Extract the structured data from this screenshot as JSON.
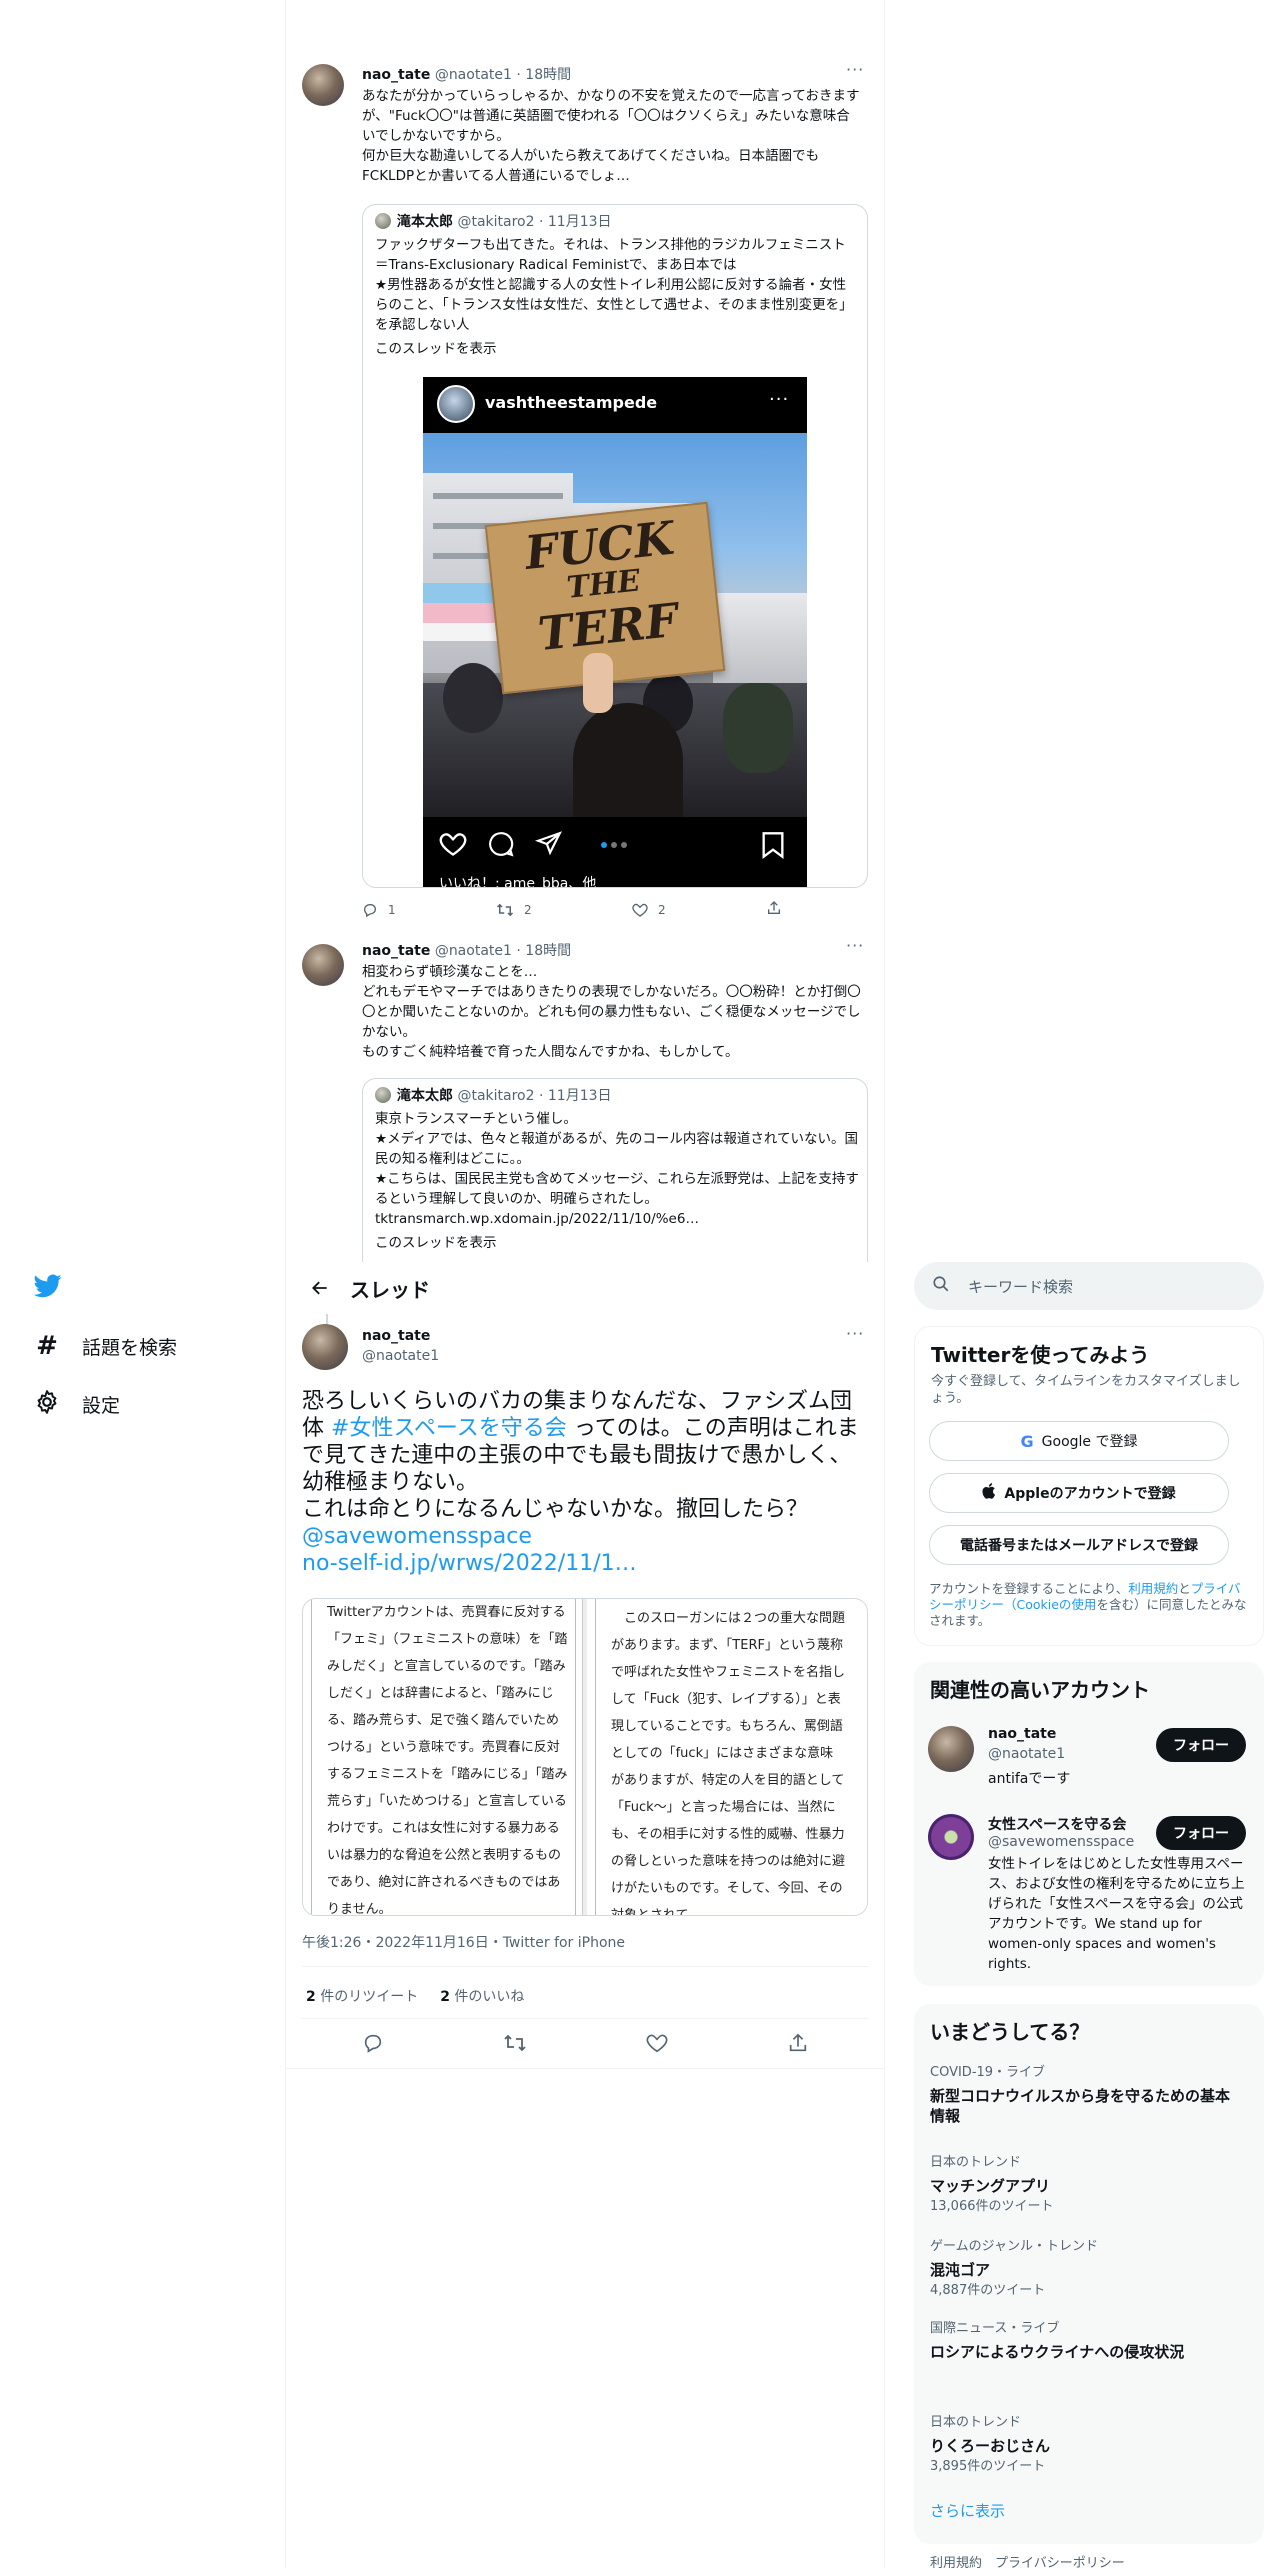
{
  "thread_top": {
    "tweet1": {
      "name": "nao_tate",
      "handle": "@naotate1",
      "time": "18時間",
      "text": "あなたが分かっていらっしゃるか、かなりの不安を覚えたので一応言っておきますが、\"Fuck〇〇\"は普通に英語圏で使われる「〇〇はクソくらえ」みたいな意味合いでしかないですから。\n何か巨大な勘違いしてる人がいたら教えてあげてくださいね。日本語圏でもFCKLDPとか書いてる人普通にいるでしょ…",
      "quote": {
        "name": "滝本太郎",
        "handle": "@takitaro2",
        "date": "11月13日",
        "text": "ファックザターフも出てきた。それは、トランス排他的ラジカルフェミニスト＝Trans-Exclusionary Radical Feministで、まあ日本では\n★男性器あるが女性と認識する人の女性トイレ利用公認に反対する論者・女性らのこと、「トランス女性は女性だ、女性として遇せよ、そのまま性別変更を」を承認しない人",
        "show_thread": "このスレッドを表示",
        "ig": {
          "username": "vashtheestampede",
          "sign_line1": "FUCK",
          "sign_line2": "THE",
          "sign_line3": "TERF",
          "likes_text": "いいね！: ame_bba、他"
        }
      },
      "replies": "1",
      "retweets": "2",
      "likes": "2"
    },
    "tweet2": {
      "name": "nao_tate",
      "handle": "@naotate1",
      "time": "18時間",
      "text": "相変わらず頓珍漢なことを…\nどれもデモやマーチではありきたりの表現でしかないだろ。〇〇粉砕！とか打倒〇〇とか聞いたことないのか。どれも何の暴力性もない、ごく穏便なメッセージでしかない。\nものすごく純粋培養で育った人間なんですかね、もしかして。",
      "quote": {
        "name": "滝本太郎",
        "handle": "@takitaro2",
        "date": "11月13日",
        "text": "東京トランスマーチという催し。\n★メディアでは、色々と報道があるが、先のコール内容は報道されていない。国民の知る権利はどこに。。\n★こちらは、国民民主党も含めてメッセージ、これら左派野党は、上記を支持するという理解して良いのか、明確らされたし。\ntktransmarch.wp.xdomain.jp/2022/11/10/%e6…",
        "show_thread": "このスレッドを表示"
      }
    }
  },
  "nav": {
    "explore": "話題を検索",
    "settings": "設定"
  },
  "header": {
    "title": "スレッド"
  },
  "main_tweet": {
    "name": "nao_tate",
    "handle": "@naotate1",
    "text_1": "恐ろしいくらいのバカの集まりなんだな、ファシズム団体",
    "hashtag": "#女性スペースを守る会",
    "text_2": "ってのは。この声明はこれまで見てきた連中の主張の中でも最も間抜けで愚かしく、幼稚極まりない。",
    "text_3": "これは命とりになるんじゃないかな。撤回したら？",
    "mention": "@savewomensspace",
    "url": "no-self-id.jp/wrws/2022/11/1…",
    "doc_left": "Twitterアカウントは、売買春に反対する「フェミ」（フェミニストの意味）を「踏みしだく」と宣言しているのです。「踏みしだく」とは辞書によると、「踏みにじる、踏み荒らす、足で強く踏んでいためつける」という意味です。売買春に反対するフェミニストを「踏みにじる」「踏み荒らす」「いためつける」と宣言しているわけです。これは女性に対する暴力あるいは暴力的な脅迫を公然と表明するものであり、絶対に許されるべきものではありません。",
    "doc_right": "このスローガンには２つの重大な問題があります。まず、「TERF」という蔑称で呼ばれた女性やフェミニストを名指しして「Fuck（犯す、レイプする）」と表現していることです。もちろん、罵倒語としての「fuck」にはさまざまな意味がありますが、特定の人を目的語として「Fuck～」と言った場合には、当然にも、その相手に対する性的威嚇、性暴力の脅しといった意味を持つのは絶対に避けがたいものです。そして、今回、その対象とされて",
    "timestamp": "午後1:26・2022年11月16日・Twitter for iPhone",
    "retweet_count": "2",
    "retweet_label": "件のリツイート",
    "like_count": "2",
    "like_label": "件のいいね"
  },
  "sidebar": {
    "search_placeholder": "キーワード検索",
    "signup": {
      "title": "Twitterを使ってみよう",
      "subtitle": "今すぐ登録して、タイムラインをカスタマイズしましょう。",
      "google": "Google で登録",
      "apple": "Appleのアカウントで登録",
      "phone": "電話番号またはメールアドレスで登録",
      "terms_prefix": "アカウントを登録することにより、",
      "terms_link": "利用規約",
      "terms_and": "と",
      "privacy_link": "プライバシーポリシー（Cookieの使用",
      "terms_suffix": "を含む）に同意したとみなされます。"
    },
    "related": {
      "title": "関連性の高いアカウント",
      "accounts": [
        {
          "name": "nao_tate",
          "handle": "@naotate1",
          "bio": "antifaでーす",
          "follow": "フォロー"
        },
        {
          "name": "女性スペースを守る会",
          "handle": "@savewomensspace",
          "bio": "女性トイレをはじめとした女性専用スペース、および女性の権利を守るために立ち上げられた「女性スペースを守る会」の公式アカウントです。We stand up for women-only spaces and women's rights.",
          "follow": "フォロー"
        }
      ]
    },
    "trends": {
      "title": "いまどうしてる？",
      "items": [
        {
          "category": "COVID-19・ライブ",
          "title": "新型コロナウイルスから身を守るための基本情報",
          "count": ""
        },
        {
          "category": "日本のトレンド",
          "title": "マッチングアプリ",
          "count": "13,066件のツイート"
        },
        {
          "category": "ゲームのジャンル・トレンド",
          "title": "混沌ゴア",
          "count": "4,887件のツイート"
        },
        {
          "category": "国際ニュース・ライブ",
          "title": "ロシアによるウクライナへの侵攻状況",
          "count": ""
        },
        {
          "category": "日本のトレンド",
          "title": "りくろーおじさん",
          "count": "3,895件のツイート"
        }
      ],
      "show_more": "さらに表示"
    },
    "footer": "利用規約　プライバシーポリシー"
  }
}
